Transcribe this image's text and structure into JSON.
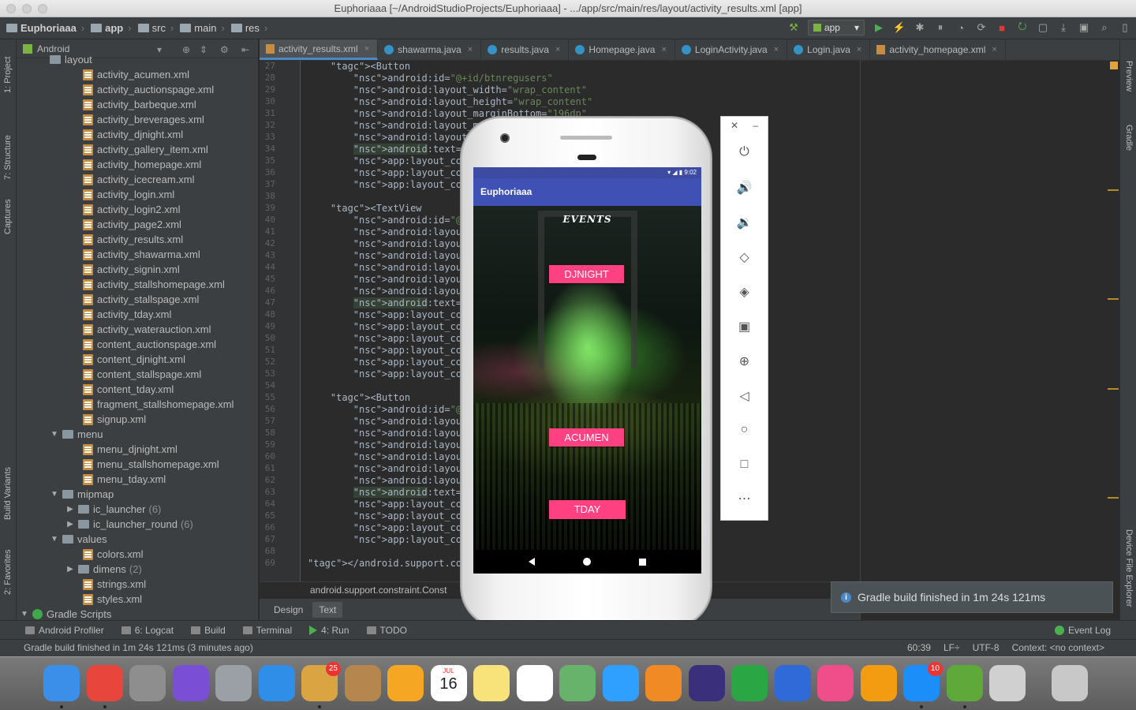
{
  "window": {
    "title": "Euphoriaaa [~/AndroidStudioProjects/Euphoriaaa] - .../app/src/main/res/layout/activity_results.xml [app]"
  },
  "navbar": {
    "crumbs": [
      "Euphoriaaa",
      "app",
      "src",
      "main",
      "res"
    ],
    "run_config": "app"
  },
  "project_panel": {
    "view_mode": "Android",
    "tree": [
      {
        "label": "layout",
        "type": "dir",
        "depth": 1
      },
      {
        "label": "activity_acumen.xml",
        "type": "xml",
        "depth": 2
      },
      {
        "label": "activity_auctionspage.xml",
        "type": "xml",
        "depth": 2
      },
      {
        "label": "activity_barbeque.xml",
        "type": "xml",
        "depth": 2
      },
      {
        "label": "activity_breverages.xml",
        "type": "xml",
        "depth": 2
      },
      {
        "label": "activity_djnight.xml",
        "type": "xml",
        "depth": 2
      },
      {
        "label": "activity_gallery_item.xml",
        "type": "xml",
        "depth": 2
      },
      {
        "label": "activity_homepage.xml",
        "type": "xml",
        "depth": 2
      },
      {
        "label": "activity_icecream.xml",
        "type": "xml",
        "depth": 2
      },
      {
        "label": "activity_login.xml",
        "type": "xml",
        "depth": 2
      },
      {
        "label": "activity_login2.xml",
        "type": "xml",
        "depth": 2
      },
      {
        "label": "activity_page2.xml",
        "type": "xml",
        "depth": 2
      },
      {
        "label": "activity_results.xml",
        "type": "xml",
        "depth": 2
      },
      {
        "label": "activity_shawarma.xml",
        "type": "xml",
        "depth": 2
      },
      {
        "label": "activity_signin.xml",
        "type": "xml",
        "depth": 2
      },
      {
        "label": "activity_stallshomepage.xml",
        "type": "xml",
        "depth": 2
      },
      {
        "label": "activity_stallspage.xml",
        "type": "xml",
        "depth": 2
      },
      {
        "label": "activity_tday.xml",
        "type": "xml",
        "depth": 2
      },
      {
        "label": "activity_waterauction.xml",
        "type": "xml",
        "depth": 2
      },
      {
        "label": "content_auctionspage.xml",
        "type": "xml",
        "depth": 2
      },
      {
        "label": "content_djnight.xml",
        "type": "xml",
        "depth": 2
      },
      {
        "label": "content_stallspage.xml",
        "type": "xml",
        "depth": 2
      },
      {
        "label": "content_tday.xml",
        "type": "xml",
        "depth": 2
      },
      {
        "label": "fragment_stallshomepage.xml",
        "type": "xml",
        "depth": 2
      },
      {
        "label": "signup.xml",
        "type": "xml",
        "depth": 2
      },
      {
        "label": "menu",
        "type": "dir",
        "depth": 1,
        "arrow": "▼"
      },
      {
        "label": "menu_djnight.xml",
        "type": "xml",
        "depth": 2
      },
      {
        "label": "menu_stallshomepage.xml",
        "type": "xml",
        "depth": 2
      },
      {
        "label": "menu_tday.xml",
        "type": "xml",
        "depth": 2
      },
      {
        "label": "mipmap",
        "type": "dir",
        "depth": 1,
        "arrow": "▼"
      },
      {
        "label": "ic_launcher",
        "type": "dir",
        "depth": 2,
        "arrow": "▶",
        "count": "(6)"
      },
      {
        "label": "ic_launcher_round",
        "type": "dir",
        "depth": 2,
        "arrow": "▶",
        "count": "(6)"
      },
      {
        "label": "values",
        "type": "dir",
        "depth": 1,
        "arrow": "▼"
      },
      {
        "label": "colors.xml",
        "type": "xml",
        "depth": 2
      },
      {
        "label": "dimens",
        "type": "dir",
        "depth": 2,
        "arrow": "▶",
        "count": "(2)"
      },
      {
        "label": "strings.xml",
        "type": "xml",
        "depth": 2
      },
      {
        "label": "styles.xml",
        "type": "xml",
        "depth": 2
      },
      {
        "label": "Gradle Scripts",
        "type": "gradle",
        "depth": 0,
        "arrow": "▼"
      }
    ]
  },
  "left_tool_tabs": [
    "1: Project",
    "7: Structure",
    "Captures",
    "Build Variants",
    "2: Favorites"
  ],
  "right_tool_tabs": [
    "Preview",
    "Gradle",
    "Device File Explorer"
  ],
  "editor_tabs": [
    {
      "label": "activity_results.xml",
      "kind": "xml",
      "active": true
    },
    {
      "label": "shawarma.java",
      "kind": "java"
    },
    {
      "label": "results.java",
      "kind": "java"
    },
    {
      "label": "Homepage.java",
      "kind": "java"
    },
    {
      "label": "LoginActivity.java",
      "kind": "java"
    },
    {
      "label": "Login.java",
      "kind": "java"
    },
    {
      "label": "activity_homepage.xml",
      "kind": "xml"
    }
  ],
  "code_lines": [
    {
      "n": "27",
      "text": "    <Button"
    },
    {
      "n": "28",
      "text": "        android:id=\"@+id/btnregusers\""
    },
    {
      "n": "29",
      "text": "        android:layout_width=\"wrap_content\""
    },
    {
      "n": "30",
      "text": "        android:layout_height=\"wrap_content\""
    },
    {
      "n": "31",
      "text": "        android:layout_marginBottom=\"196dp\""
    },
    {
      "n": "32",
      "text": "        android:layout_marginEn"
    },
    {
      "n": "33",
      "text": "        android:layout_margin"
    },
    {
      "n": "34",
      "text": "        android:text=\"Get re",
      "hl": true
    },
    {
      "n": "35",
      "text": "        app:layout_constrai"
    },
    {
      "n": "36",
      "text": "        app:layout_constrai"
    },
    {
      "n": "37",
      "text": "        app:layout_constrai"
    },
    {
      "n": "38",
      "text": ""
    },
    {
      "n": "39",
      "text": "    <TextView"
    },
    {
      "n": "40",
      "text": "        android:id=\"@+id/res"
    },
    {
      "n": "41",
      "text": "        android:layout_width"
    },
    {
      "n": "42",
      "text": "        android:layout_heigh"
    },
    {
      "n": "43",
      "text": "        android:layout_margi"
    },
    {
      "n": "44",
      "text": "        android:layout_margi"
    },
    {
      "n": "45",
      "text": "        android:layout_margi"
    },
    {
      "n": "46",
      "text": "        android:layout_margi"
    },
    {
      "n": "47",
      "text": "        android:text=\"Pranay",
      "hl": true
    },
    {
      "n": "48",
      "text": "        app:layout_constrai"
    },
    {
      "n": "49",
      "text": "        app:layout_constrai"
    },
    {
      "n": "50",
      "text": "        app:layout_constrai"
    },
    {
      "n": "51",
      "text": "        app:layout_constrai"
    },
    {
      "n": "52",
      "text": "        app:layout_constrai"
    },
    {
      "n": "53",
      "text": "        app:layout_constrai"
    },
    {
      "n": "54",
      "text": ""
    },
    {
      "n": "55",
      "text": "    <Button"
    },
    {
      "n": "56",
      "text": "        android:id=\"@+id/bac"
    },
    {
      "n": "57",
      "text": "        android:layout_width"
    },
    {
      "n": "58",
      "text": "        android:layout_heigh"
    },
    {
      "n": "59",
      "text": "        android:layout_margi"
    },
    {
      "n": "60",
      "text": "        android:layout_margi"
    },
    {
      "n": "61",
      "text": "        android:layout_margi"
    },
    {
      "n": "62",
      "text": "        android:layout_margi"
    },
    {
      "n": "63",
      "text": "        android:text=\"Go bac",
      "hl": true
    },
    {
      "n": "64",
      "text": "        app:layout_constrai"
    },
    {
      "n": "65",
      "text": "        app:layout_constrai"
    },
    {
      "n": "66",
      "text": "        app:layout_constrai"
    },
    {
      "n": "67",
      "text": "        app:layout_constrai"
    },
    {
      "n": "68",
      "text": ""
    },
    {
      "n": "69",
      "text": "</android.support.constraint"
    }
  ],
  "editor_breadcrumb": "android.support.constraint.Const",
  "design_tabs": {
    "design": "Design",
    "text": "Text"
  },
  "emulator": {
    "status_time": "9:02",
    "app_title": "Euphoriaaa",
    "screen_heading": "EVENTS",
    "buttons": [
      "DJNIGHT",
      "ACUMEN",
      "TDAY"
    ],
    "accent": "#ff4081",
    "primary": "#3f51b5"
  },
  "emulator_controls": [
    "close-icon",
    "minimize-icon",
    "power-icon",
    "volume-up-icon",
    "volume-down-icon",
    "rotate-left-icon",
    "rotate-right-icon",
    "camera-icon",
    "zoom-icon",
    "back-icon",
    "home-icon",
    "overview-icon",
    "more-icon"
  ],
  "notification": {
    "text": "Gradle build finished in 1m 24s 121ms"
  },
  "bottom_tools": [
    {
      "label": "Android Profiler"
    },
    {
      "label": "6: Logcat"
    },
    {
      "label": "Build"
    },
    {
      "label": "Terminal"
    },
    {
      "label": "4: Run"
    },
    {
      "label": "TODO"
    }
  ],
  "event_log": "Event Log",
  "statusbar": {
    "message": "Gradle build finished in 1m 24s 121ms (3 minutes ago)",
    "position": "60:39",
    "line_sep": "LF÷",
    "encoding": "UTF-8",
    "context": "Context: <no context>"
  },
  "dock": {
    "apps": [
      "Finder",
      "Chrome",
      "System Preferences",
      "Siri",
      "Launchpad",
      "Safari",
      "Mail",
      "Contacts",
      "Photos",
      "Calendar",
      "Notes",
      "Reminders",
      "Maps",
      "Messages",
      "Pages",
      "Eclipse",
      "Numbers",
      "Keynote",
      "iTunes",
      "iBooks",
      "App Store",
      "Android Studio",
      "Genymotion",
      "Trash"
    ],
    "mail_badge": "25",
    "appstore_badge": "10",
    "calendar_month": "JUL",
    "calendar_day": "16"
  }
}
